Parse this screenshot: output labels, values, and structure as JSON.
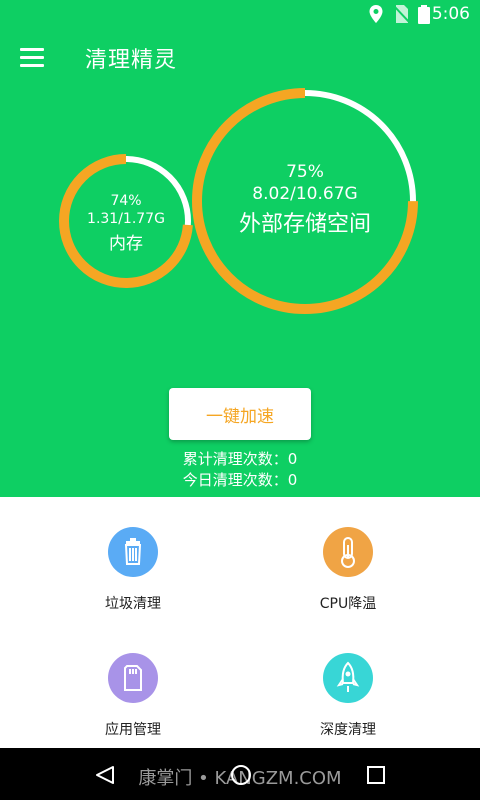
{
  "status_bar": {
    "time": "5:06",
    "icons": [
      "location-icon",
      "no-sim-icon",
      "battery-icon"
    ]
  },
  "app_bar": {
    "title": "清理精灵",
    "menu_icon": "menu-icon"
  },
  "memory": {
    "percent": "74%",
    "percent_value": 74,
    "usage": "1.31/1.77G",
    "label": "内存"
  },
  "storage": {
    "percent": "75%",
    "percent_value": 75,
    "usage": "8.02/10.67G",
    "label": "外部存储空间"
  },
  "boost_button": {
    "label": "一键加速"
  },
  "stats": {
    "total_clean": "累计清理次数：0",
    "today_clean": "今日清理次数：0"
  },
  "tools": [
    {
      "label": "垃圾清理",
      "icon": "trash-icon",
      "color": "#5aabf5"
    },
    {
      "label": "CPU降温",
      "icon": "thermometer-icon",
      "color": "#f0a445"
    },
    {
      "label": "应用管理",
      "icon": "sd-card-icon",
      "color": "#a893e8"
    },
    {
      "label": "深度清理",
      "icon": "rocket-icon",
      "color": "#38d6d6"
    }
  ],
  "nav_bar": {
    "watermark": "康掌门 • KANGZM.COM",
    "icons": [
      "back-icon",
      "home-icon",
      "recents-icon"
    ]
  },
  "colors": {
    "primary": "#0ecf63",
    "accent": "#f5a623"
  }
}
